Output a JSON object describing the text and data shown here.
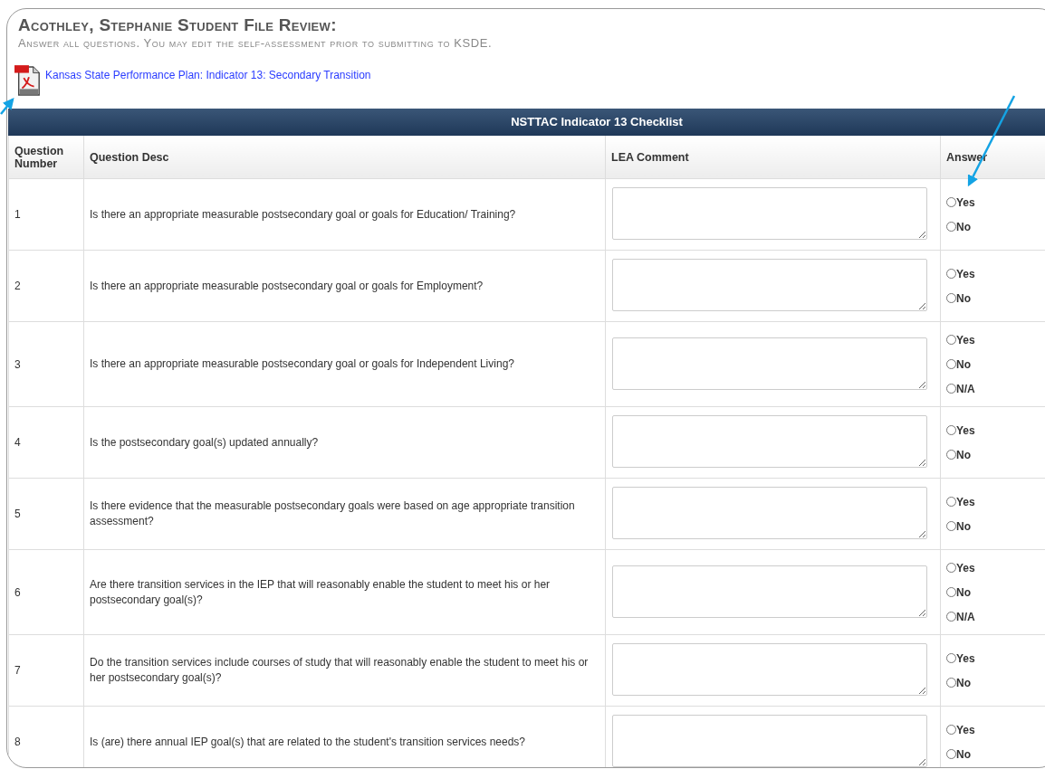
{
  "title": "Acothley, Stephanie Student File Review:",
  "instructions": "Answer all questions. You may edit the self-assessment prior to submitting to KSDE.",
  "document_link": {
    "label": "Kansas State Performance Plan: Indicator 13: Secondary Transition"
  },
  "table": {
    "title": "NSTTAC Indicator 13 Checklist",
    "columns": [
      "Question Number",
      "Question Desc",
      "LEA Comment",
      "Answer"
    ],
    "rows": [
      {
        "number": "1",
        "question": "Is there an appropriate measurable postsecondary goal or goals for Education/ Training?",
        "answers": [
          {
            "label": "Yes",
            "selected": false
          },
          {
            "label": "No",
            "selected": false
          }
        ]
      },
      {
        "number": "2",
        "question": "Is there an appropriate measurable postsecondary goal or goals for Employment?",
        "answers": [
          {
            "label": "Yes",
            "selected": false
          },
          {
            "label": "No",
            "selected": false
          }
        ]
      },
      {
        "number": "3",
        "question": "Is there an appropriate measurable postsecondary goal or goals for Independent Living?",
        "answers": [
          {
            "label": "Yes",
            "selected": false
          },
          {
            "label": "No",
            "selected": false
          },
          {
            "label": "N/A",
            "selected": false
          }
        ]
      },
      {
        "number": "4",
        "question": "Is the postsecondary goal(s) updated annually?",
        "answers": [
          {
            "label": "Yes",
            "selected": false
          },
          {
            "label": "No",
            "selected": false
          }
        ]
      },
      {
        "number": "5",
        "question": "Is there evidence that the measurable postsecondary goals were based on age appropriate transition assessment?",
        "answers": [
          {
            "label": "Yes",
            "selected": false
          },
          {
            "label": "No",
            "selected": false
          }
        ]
      },
      {
        "number": "6",
        "question": "Are there transition services in the IEP that will reasonably enable the student to meet his or her postsecondary goal(s)?",
        "answers": [
          {
            "label": "Yes",
            "selected": false
          },
          {
            "label": "No",
            "selected": false
          },
          {
            "label": "N/A",
            "selected": false
          }
        ]
      },
      {
        "number": "7",
        "question": "Do the transition services include courses of study that will reasonably enable the student to meet his or her postsecondary goal(s)?",
        "answers": [
          {
            "label": "Yes",
            "selected": false
          },
          {
            "label": "No",
            "selected": false
          }
        ]
      },
      {
        "number": "8",
        "question": "Is (are) there annual IEP goal(s) that are related to the student's transition services needs?",
        "answers": [
          {
            "label": "Yes",
            "selected": false
          },
          {
            "label": "No",
            "selected": false
          }
        ]
      }
    ]
  }
}
